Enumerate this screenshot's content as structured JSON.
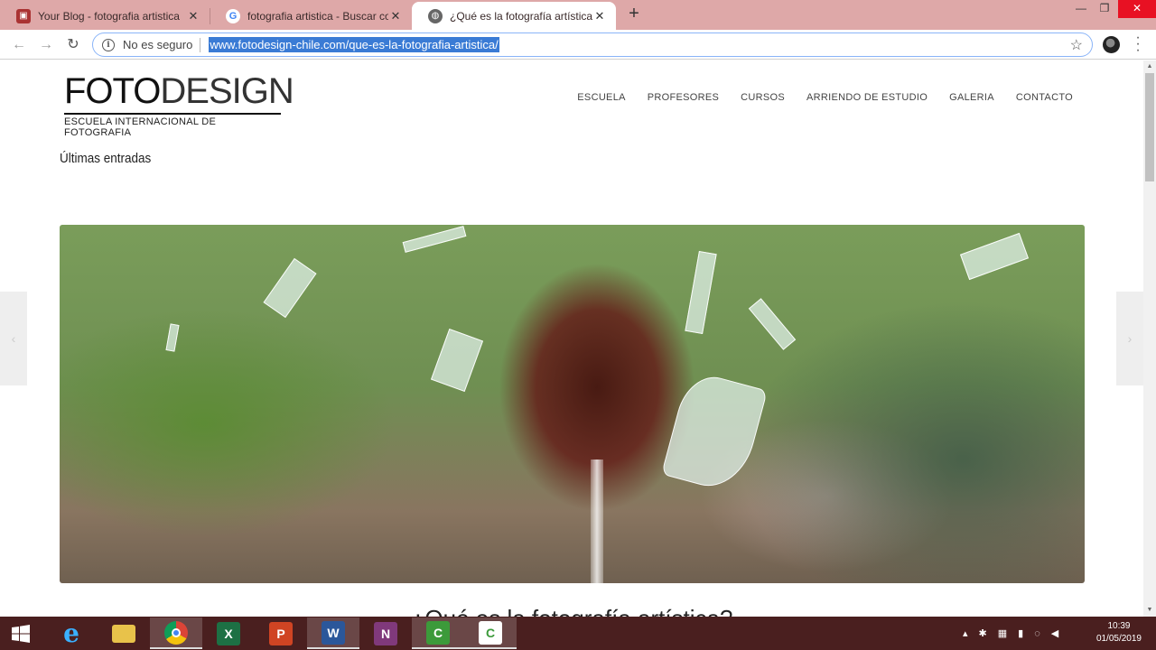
{
  "browser": {
    "tabs": [
      {
        "title": "Your Blog - fotografia artistica",
        "favicon": "blogger-icon",
        "active": false
      },
      {
        "title": "fotografia artistica - Buscar con G",
        "favicon": "google-icon",
        "active": false
      },
      {
        "title": "¿Qué es la fotografía artística? - F",
        "favicon": "globe-icon",
        "active": true
      }
    ],
    "new_tab_label": "+",
    "window_controls": {
      "minimize": "—",
      "maximize": "❐",
      "close": "✕"
    },
    "security_label": "No es seguro",
    "url": "www.fotodesign-chile.com/que-es-la-fotografia-artistica/"
  },
  "site": {
    "logo_main_bold": "FOTO",
    "logo_main_light": "DESIGN",
    "logo_sub": "ESCUELA INTERNACIONAL DE FOTOGRAFIA",
    "nav": [
      "ESCUELA",
      "PROFESORES",
      "CURSOS",
      "ARRIENDO DE ESTUDIO",
      "GALERIA",
      "CONTACTO"
    ],
    "section_title": "Últimas entradas",
    "article_title": "¿Qué es la fotografía artística?",
    "slider_prev": "‹",
    "slider_next": "›"
  },
  "taskbar": {
    "apps": [
      {
        "name": "start-button",
        "label": ""
      },
      {
        "name": "internet-explorer",
        "label": "e"
      },
      {
        "name": "file-explorer",
        "label": ""
      },
      {
        "name": "chrome",
        "label": ""
      },
      {
        "name": "excel",
        "label": "X"
      },
      {
        "name": "powerpoint",
        "label": "P"
      },
      {
        "name": "word",
        "label": "W"
      },
      {
        "name": "onenote",
        "label": "N"
      },
      {
        "name": "camtasia-1",
        "label": "C"
      },
      {
        "name": "camtasia-2",
        "label": "C"
      }
    ],
    "clock_time": "10:39",
    "clock_date": "01/05/2019"
  }
}
